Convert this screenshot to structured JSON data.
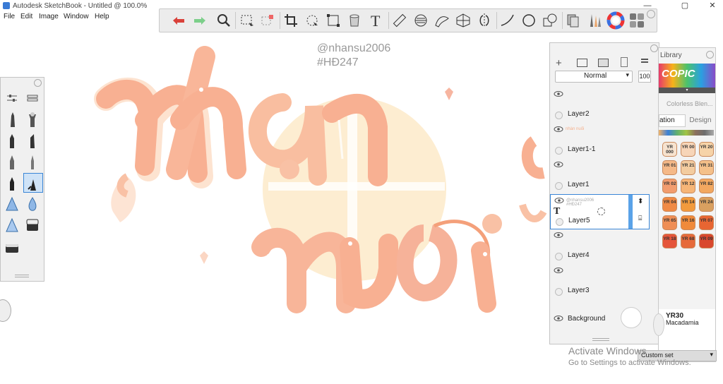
{
  "window": {
    "title": "Autodesk SketchBook - Untitled @ 100.0%",
    "minimize": "—",
    "maximize": "▢",
    "close": "✕"
  },
  "menu": [
    "File",
    "Edit",
    "Image",
    "Window",
    "Help"
  ],
  "toolbar": {
    "tools": [
      "undo-icon",
      "redo-icon",
      "magnifier-icon",
      "select-rect-icon",
      "select-lasso-icon",
      "crop-icon",
      "transform-icon",
      "distort-icon",
      "fill-icon",
      "text-icon",
      "ruler-icon",
      "ellipse-guide-icon",
      "french-curve-icon",
      "perspective-icon",
      "symmetry-icon",
      "curve-stroke-icon",
      "circle-icon",
      "shape-icon",
      "copic-library-icon",
      "brush-library-icon",
      "color-wheel-icon",
      "brush-grid-icon"
    ]
  },
  "canvas": {
    "handle": "@nhansu2006",
    "hashtag": "#HĐ247",
    "lettering": "nhàn nuối",
    "colors": {
      "lettering": "#f7a585",
      "highlight": "#ffe4d2",
      "sun": "#fde9c6",
      "shadow": "#fde3d0"
    }
  },
  "layers_panel": {
    "blend_mode": "Normal",
    "opacity": "100",
    "layers": [
      {
        "name": "Layer2",
        "thumb": ""
      },
      {
        "name": "Layer1-1",
        "thumb": "nhàn nuối"
      },
      {
        "name": "Layer1",
        "thumb": ""
      },
      {
        "name": "Layer5",
        "thumb": "@nhansu2006 #HĐ247",
        "selected": true
      },
      {
        "name": "Layer4",
        "thumb": ""
      },
      {
        "name": "Layer3",
        "thumb": ""
      }
    ],
    "background_label": "Background"
  },
  "copic_panel": {
    "title": "Library",
    "brand": "COPIC",
    "colorless": "Colorless Blen...",
    "tabs": [
      "ation",
      "Design"
    ],
    "swatches": [
      {
        "code": "YR\n000",
        "color": "#f7e3cf"
      },
      {
        "code": "YR\n00",
        "color": "#f7d5b8"
      },
      {
        "code": "YR\n20",
        "color": "#f6d3a8"
      },
      {
        "code": "YR\n01",
        "color": "#f5b988"
      },
      {
        "code": "YR\n21",
        "color": "#f3cca0"
      },
      {
        "code": "YR\n31",
        "color": "#f4c08a"
      },
      {
        "code": "YR\n02",
        "color": "#f29c6e"
      },
      {
        "code": "YR\n12",
        "color": "#f6b577"
      },
      {
        "code": "YR\n82",
        "color": "#f2a860"
      },
      {
        "code": "YR\n04",
        "color": "#f08a45"
      },
      {
        "code": "YR\n14",
        "color": "#f29a3d"
      },
      {
        "code": "YR\n24",
        "color": "#d9a060"
      },
      {
        "code": "YR\n65",
        "color": "#ef8e55"
      },
      {
        "code": "YR\n16",
        "color": "#f08a3a"
      },
      {
        "code": "YR\n07",
        "color": "#e86532"
      },
      {
        "code": "YR\n18",
        "color": "#e5553a"
      },
      {
        "code": "YR\n68",
        "color": "#e66a3a"
      },
      {
        "code": "YR\n09",
        "color": "#d9482e"
      }
    ],
    "selected_code": "YR30",
    "selected_name": "Macadamia",
    "set_label": "Custom set"
  },
  "os_watermark": {
    "line1": "Activate Windows",
    "line2": "Go to Settings to activate Windows."
  }
}
